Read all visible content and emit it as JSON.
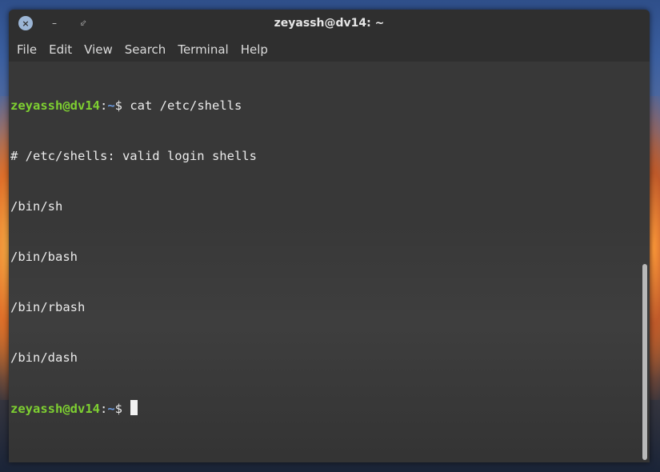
{
  "window": {
    "title": "zeyassh@dv14: ~",
    "controls": {
      "close": "×",
      "minimize": "–",
      "maximize": "⬃"
    }
  },
  "menubar": {
    "items": [
      {
        "label": "File"
      },
      {
        "label": "Edit"
      },
      {
        "label": "View"
      },
      {
        "label": "Search"
      },
      {
        "label": "Terminal"
      },
      {
        "label": "Help"
      }
    ]
  },
  "terminal": {
    "prompt": {
      "user_host": "zeyassh@dv14",
      "separator": ":",
      "path": "~",
      "symbol": "$"
    },
    "command": " cat /etc/shells",
    "output": [
      "# /etc/shells: valid login shells",
      "/bin/sh",
      "/bin/bash",
      "/bin/rbash",
      "/bin/dash"
    ],
    "colors": {
      "user_host": "#7ed031",
      "path": "#6c9be0",
      "text": "#ececec",
      "background": "#383838"
    }
  }
}
